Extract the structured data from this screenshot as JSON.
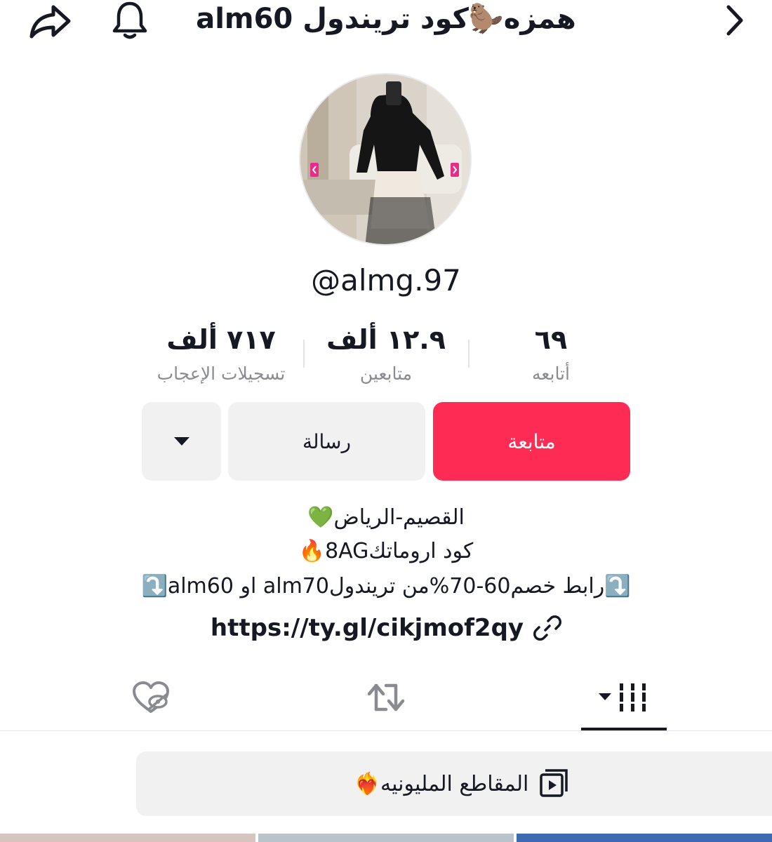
{
  "header": {
    "title": "همزه🦫كود تريندول alm60",
    "share_icon": "share-arrow-icon",
    "bell_icon": "bell-icon",
    "back_icon": "chevron-right-icon"
  },
  "profile": {
    "handle": "@almg.97",
    "avatar_icon": "profile-photo"
  },
  "stats": {
    "likes": {
      "value": "٧١٧ ألف",
      "label": "تسجيلات الإعجاب"
    },
    "followers": {
      "value": "١٢.٩ ألف",
      "label": "متابعين"
    },
    "following": {
      "value": "٦٩",
      "label": "أتابعه"
    }
  },
  "actions": {
    "follow_label": "متابعة",
    "message_label": "رسالة",
    "more_icon": "caret-down-icon"
  },
  "bio": {
    "line1": "القصيم-الرياض💚",
    "line2": "كود اروماتك8AG🔥",
    "line3": "⤵️رابط خصم60-70%من تريندولalm70 او alm60⤵️",
    "link": "https://ty.gl/cikjmof2qy",
    "link_icon": "link-icon"
  },
  "tabs": {
    "videos_icon": "grid-bars-icon",
    "reposts_icon": "repost-icon",
    "liked_icon": "hidden-heart-icon",
    "active": "videos"
  },
  "playlist": {
    "label": "المقاطع المليونيه❤️‍🔥",
    "icon": "playlist-icon"
  },
  "colors": {
    "accent": "#fe2c55",
    "button_gray": "#f1f1f2",
    "text": "#161823",
    "muted": "#8a8b91"
  }
}
